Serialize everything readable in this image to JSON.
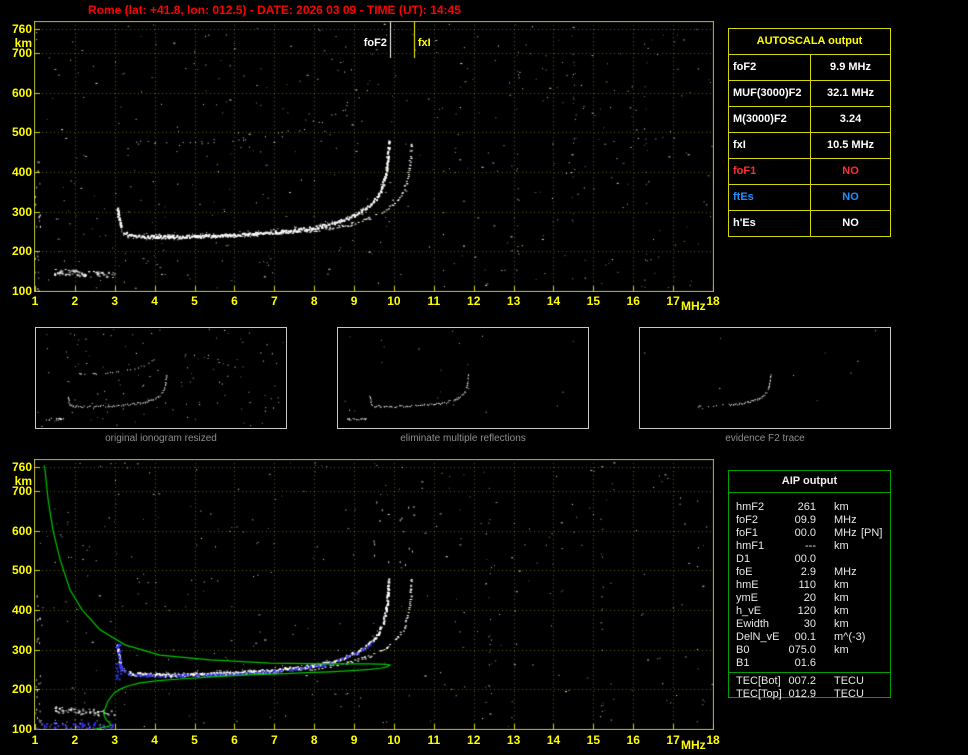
{
  "title": "Rome (lat: +41.8, lon: 012.5) - DATE: 2026 03 09 - TIME (UT): 14:45",
  "axis": {
    "x_unit": "MHz",
    "y_unit": "km",
    "x_ticks": [
      1,
      2,
      3,
      4,
      5,
      6,
      7,
      8,
      9,
      10,
      11,
      12,
      13,
      14,
      15,
      16,
      17,
      18
    ],
    "y_ticks": [
      760,
      700,
      600,
      500,
      400,
      300,
      200,
      100
    ]
  },
  "autoscala": {
    "title": "AUTOSCALA output",
    "rows": [
      {
        "label": "foF2",
        "value": "9.9 MHz",
        "color": "#ffffff"
      },
      {
        "label": "MUF(3000)F2",
        "value": "32.1 MHz",
        "color": "#ffffff"
      },
      {
        "label": "M(3000)F2",
        "value": "3.24",
        "color": "#ffffff"
      },
      {
        "label": "fxI",
        "value": "10.5 MHz",
        "color": "#ffffff"
      },
      {
        "label": "foF1",
        "value": "NO",
        "color": "#ff3030"
      },
      {
        "label": "ftEs",
        "value": "NO",
        "color": "#1e90ff"
      },
      {
        "label": "h'Es",
        "value": "NO",
        "color": "#ffffff"
      }
    ]
  },
  "thumbnails": [
    {
      "caption": "original ionogram resized"
    },
    {
      "caption": "eliminate multiple reflections"
    },
    {
      "caption": "evidence F2 trace"
    }
  ],
  "aip": {
    "title": "AIP output",
    "rows": [
      {
        "label": "hmF2",
        "value": "261",
        "unit": "km"
      },
      {
        "label": "foF2",
        "value": "09.9",
        "unit": "MHz"
      },
      {
        "label": "foF1",
        "value": "00.0",
        "unit": "MHz",
        "note": "[PN]"
      },
      {
        "label": "hmF1",
        "value": "---",
        "unit": "km"
      },
      {
        "label": "D1",
        "value": "00.0",
        "unit": ""
      },
      {
        "label": "foE",
        "value": "2.9",
        "unit": "MHz"
      },
      {
        "label": "hmE",
        "value": "110",
        "unit": "km"
      },
      {
        "label": "ymE",
        "value": "20",
        "unit": "km"
      },
      {
        "label": "h_vE",
        "value": "120",
        "unit": "km"
      },
      {
        "label": "Ewidth",
        "value": "30",
        "unit": "km"
      },
      {
        "label": "DelN_vE",
        "value": "00.1",
        "unit": "m^(-3)"
      },
      {
        "label": "B0",
        "value": "075.0",
        "unit": "km"
      },
      {
        "label": "B1",
        "value": "01.6",
        "unit": ""
      }
    ],
    "tec_rows": [
      {
        "label": "TEC[Bot]",
        "value": "007.2",
        "unit": "TECU"
      },
      {
        "label": "TEC[Top]",
        "value": "012.9",
        "unit": "TECU"
      }
    ]
  },
  "chart_data": {
    "type": "scatter",
    "title": "Vertical incidence ionogram, Rome, 2026-03-09 14:45 UT",
    "xlabel": "MHz",
    "ylabel": "km",
    "x_range": [
      1,
      18
    ],
    "y_range": [
      100,
      760
    ],
    "grid": "dotted",
    "markers": [
      {
        "label": "foF2",
        "freq": 9.9,
        "color": "#ffffff",
        "side": "left"
      },
      {
        "label": "fxI",
        "freq": 10.5,
        "color": "#ffff00",
        "side": "right"
      }
    ],
    "o_trace": [
      [
        3.05,
        312
      ],
      [
        3.08,
        290
      ],
      [
        3.12,
        268
      ],
      [
        3.18,
        252
      ],
      [
        3.3,
        244
      ],
      [
        3.5,
        240
      ],
      [
        4.0,
        238
      ],
      [
        4.5,
        238
      ],
      [
        5.0,
        239
      ],
      [
        5.5,
        241
      ],
      [
        6.0,
        243
      ],
      [
        6.5,
        246
      ],
      [
        7.0,
        250
      ],
      [
        7.5,
        255
      ],
      [
        8.0,
        262
      ],
      [
        8.3,
        268
      ],
      [
        8.6,
        277
      ],
      [
        8.9,
        288
      ],
      [
        9.1,
        297
      ],
      [
        9.3,
        310
      ],
      [
        9.45,
        324
      ],
      [
        9.6,
        343
      ],
      [
        9.7,
        365
      ],
      [
        9.78,
        395
      ],
      [
        9.82,
        425
      ],
      [
        9.85,
        462
      ],
      [
        9.86,
        480
      ]
    ],
    "x_mode_freq_offset": 0.57,
    "es_trace_range": {
      "f": [
        1.45,
        3.0
      ],
      "h": [
        128,
        165
      ]
    },
    "profile": [
      [
        2.5,
        100
      ],
      [
        2.7,
        104
      ],
      [
        2.85,
        107
      ],
      [
        2.9,
        110
      ],
      [
        2.86,
        116
      ],
      [
        2.79,
        123
      ],
      [
        2.74,
        132
      ],
      [
        2.72,
        141
      ],
      [
        2.75,
        150
      ],
      [
        2.79,
        160
      ],
      [
        2.83,
        170
      ],
      [
        2.92,
        182
      ],
      [
        3.0,
        192
      ],
      [
        3.15,
        201
      ],
      [
        3.35,
        209
      ],
      [
        3.63,
        216
      ],
      [
        4.1,
        222
      ],
      [
        4.64,
        226
      ],
      [
        5.25,
        230
      ],
      [
        5.89,
        234
      ],
      [
        6.5,
        237
      ],
      [
        7.14,
        239
      ],
      [
        7.8,
        242
      ],
      [
        8.4,
        244
      ],
      [
        8.95,
        247
      ],
      [
        9.4,
        250
      ],
      [
        9.65,
        253
      ],
      [
        9.82,
        256
      ],
      [
        9.9,
        261
      ],
      [
        9.82,
        263
      ],
      [
        9.4,
        264
      ],
      [
        8.4,
        264
      ],
      [
        6.89,
        266
      ],
      [
        5.39,
        274
      ],
      [
        4.13,
        286
      ],
      [
        3.26,
        312
      ],
      [
        2.63,
        350
      ],
      [
        2.18,
        400
      ],
      [
        1.88,
        450
      ],
      [
        1.63,
        526
      ],
      [
        1.45,
        601
      ],
      [
        1.33,
        677
      ],
      [
        1.25,
        753
      ],
      [
        1.23,
        764
      ]
    ],
    "profile_color": "#00c400",
    "restored_trace_color": "#3333ee",
    "trace_color": "#ffffff",
    "axis_color": "#ffff00"
  }
}
